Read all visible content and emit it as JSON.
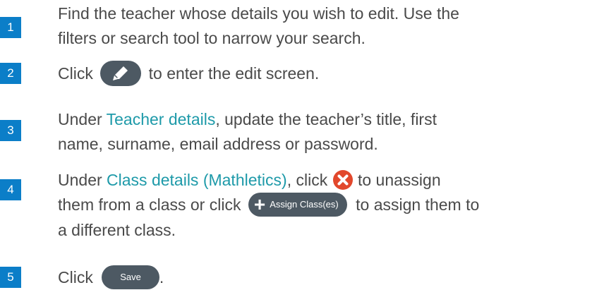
{
  "steps": [
    {
      "number": "1",
      "line1": "Find the teacher whose details you wish to edit. Use the",
      "line2": "filters or search tool to narrow your search."
    },
    {
      "number": "2",
      "pre": "Click",
      "post": "to enter the edit screen.",
      "icon": "pencil-icon"
    },
    {
      "number": "3",
      "pre": "Under ",
      "highlight": "Teacher details",
      "post": ", update the teacher’s title, first",
      "line2": "name, surname, email address or password."
    },
    {
      "number": "4",
      "pre": "Under ",
      "highlight": "Class details (Mathletics)",
      "mid": ", click",
      "post": "to unassign",
      "line2_pre": "them from a class or click",
      "assign_label": "Assign Class(es)",
      "line2_post": "to assign them to",
      "line3": "a different class.",
      "remove_icon": "close-circle-icon"
    },
    {
      "number": "5",
      "pre": "Click",
      "save_label": "Save",
      "post": "."
    }
  ],
  "colors": {
    "badge": "#0b7ec8",
    "highlight": "#1e9aa9",
    "button": "#4d5963",
    "remove": "#e2482c",
    "text": "#4a4a4a"
  }
}
